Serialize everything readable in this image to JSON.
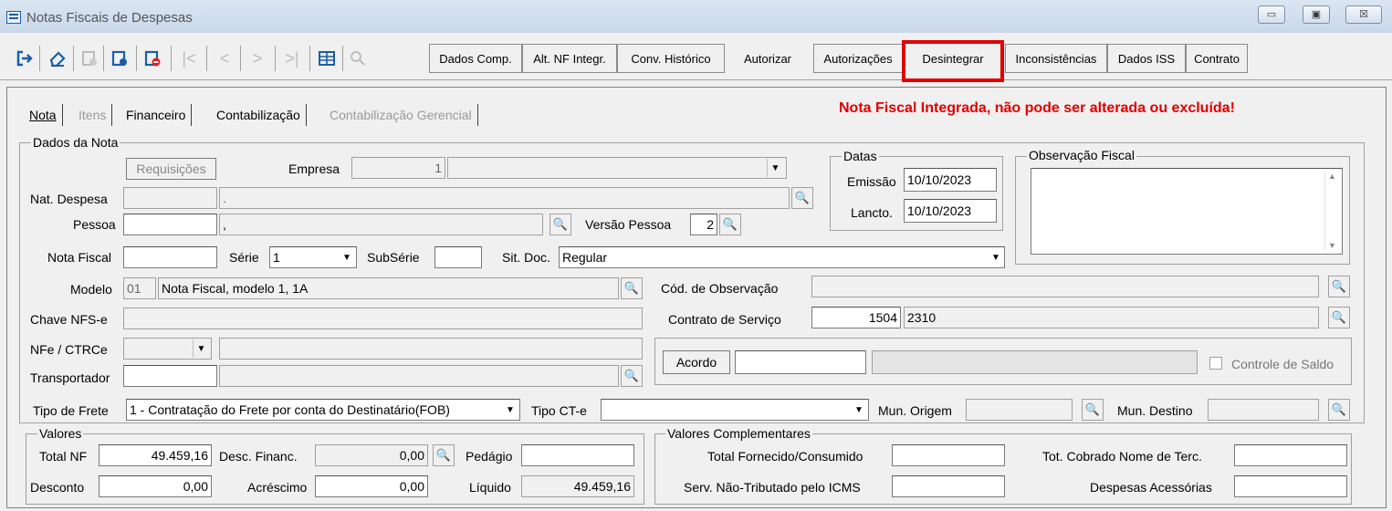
{
  "window": {
    "title": "Notas Fiscais de Despesas",
    "min": "▭",
    "max": "▣",
    "close": "☒"
  },
  "toolbar": {
    "buttons": [
      "Dados Comp.",
      "Alt. NF Integr.",
      "Conv. Histórico",
      "Autorizar",
      "Autorizações",
      "Desintegrar",
      "Inconsistências",
      "Dados ISS",
      "Contrato"
    ]
  },
  "tabs": [
    "Nota",
    "Itens",
    "Financeiro",
    "Contabilização",
    "Contabilização Gerencial"
  ],
  "warning": "Nota Fiscal Integrada, não pode ser alterada ou excluída!",
  "dados": {
    "group": "Dados da Nota",
    "requisicoes": "Requisições",
    "empresa_label": "Empresa",
    "empresa_code": "1",
    "nat_label": "Nat. Despesa",
    "nat_text": ".",
    "pessoa_label": "Pessoa",
    "pessoa_text": ",",
    "versao_label": "Versão Pessoa",
    "versao_value": "2",
    "nf_label": "Nota Fiscal",
    "serie_label": "Série",
    "serie_value": "1",
    "subserie_label": "SubSérie",
    "sitdoc_label": "Sit. Doc.",
    "sitdoc_value": "Regular",
    "modelo_label": "Modelo",
    "modelo_code": "01",
    "modelo_text": "Nota Fiscal, modelo 1, 1A",
    "chave_label": "Chave NFS-e",
    "nfe_label": "NFe / CTRCe",
    "transp_label": "Transportador",
    "codobs_label": "Cód. de Observação",
    "contrato_label": "Contrato de Serviço",
    "contrato_code": "1504",
    "contrato_text": "2310",
    "acordo": "Acordo",
    "controle": "Controle de Saldo",
    "frete_label": "Tipo de Frete",
    "frete_value": "1 - Contratação do Frete por conta do Destinatário(FOB)",
    "tipocte_label": "Tipo CT-e",
    "munorig_label": "Mun. Origem",
    "mundest_label": "Mun. Destino"
  },
  "datas": {
    "group": "Datas",
    "emissao_label": "Emissão",
    "emissao": "10/10/2023",
    "lancto_label": "Lancto.",
    "lancto": "10/10/2023"
  },
  "obs": {
    "group": "Observação Fiscal"
  },
  "valores": {
    "group": "Valores",
    "total_label": "Total NF",
    "total": "49.459,16",
    "desc_fin_label": "Desc. Financ.",
    "desc_fin": "0,00",
    "pedagio_label": "Pedágio",
    "desconto_label": "Desconto",
    "desconto": "0,00",
    "acrescimo_label": "Acréscimo",
    "acrescimo": "0,00",
    "liquido_label": "Líquido",
    "liquido": "49.459,16"
  },
  "comp": {
    "group": "Valores Complementares",
    "total_forn_label": "Total Fornecido/Consumido",
    "serv_label": "Serv. Não-Tributado pelo ICMS",
    "tot_cobr_label": "Tot. Cobrado Nome de Terc.",
    "desp_label": "Despesas Acessórias"
  }
}
